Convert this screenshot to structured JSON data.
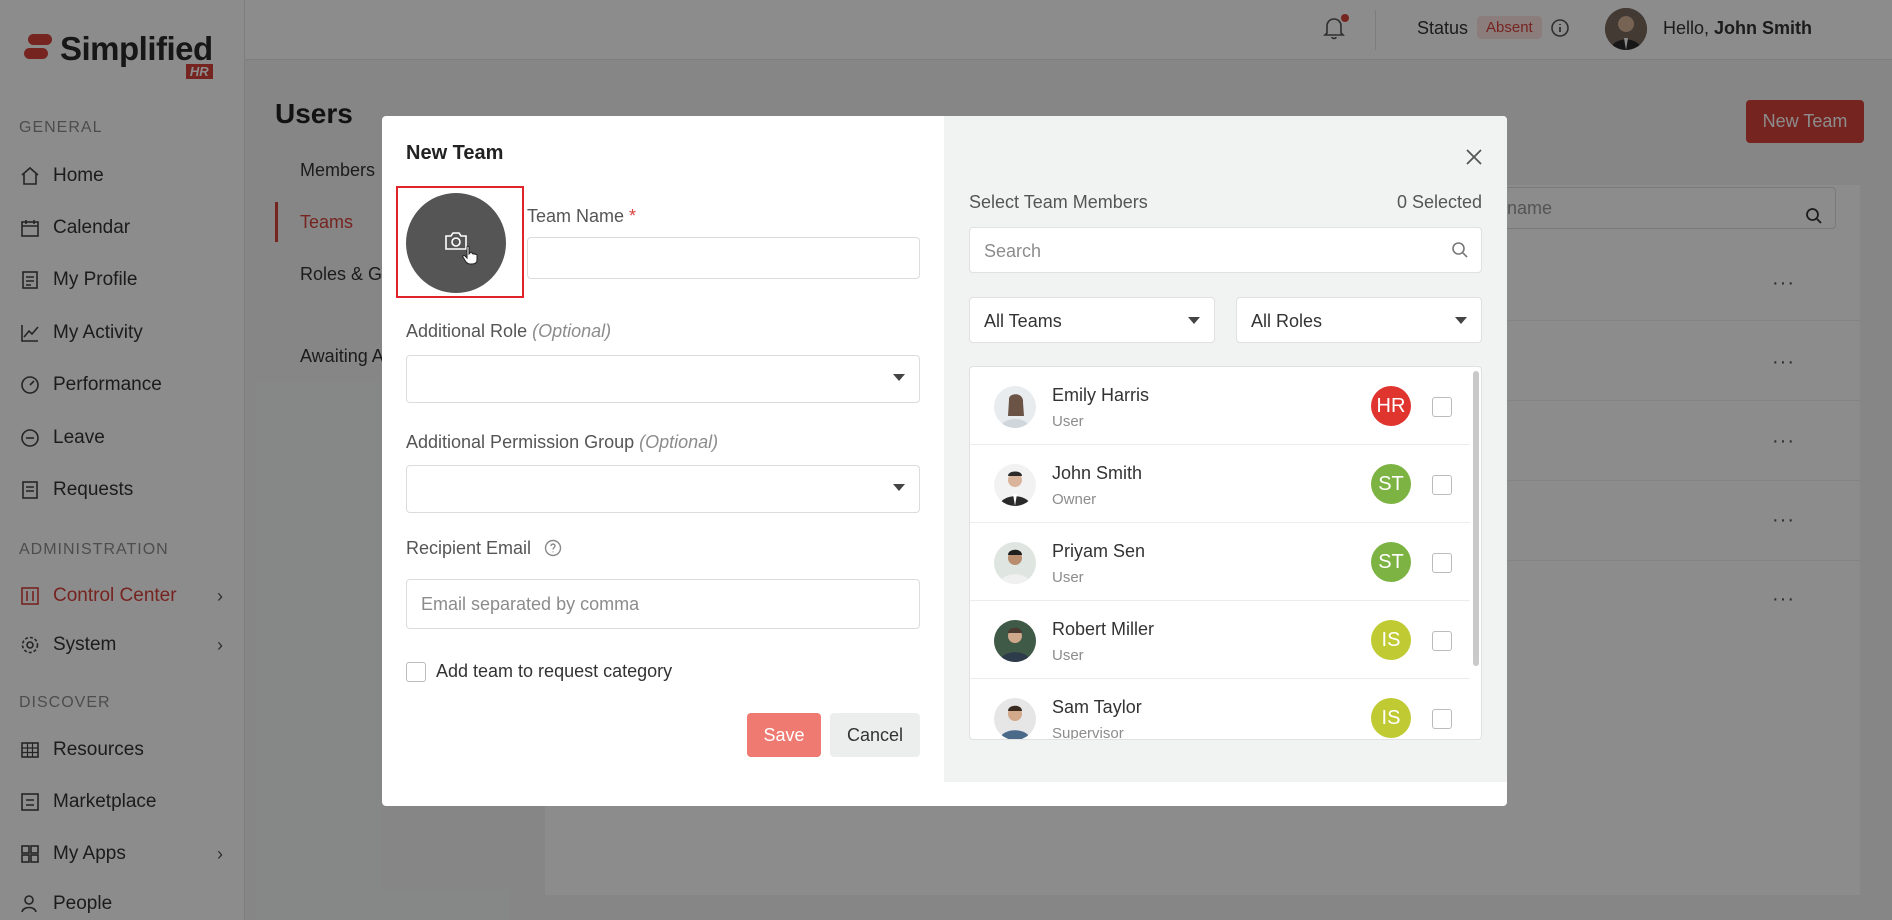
{
  "app": {
    "logo_text": "Simplified",
    "logo_badge": "HR",
    "brand_color": "#d8433b"
  },
  "sidebar": {
    "sections": [
      {
        "label": "GENERAL"
      },
      {
        "label": "ADMINISTRATION"
      },
      {
        "label": "DISCOVER"
      }
    ],
    "items": [
      {
        "label": "Home",
        "icon": "home-icon"
      },
      {
        "label": "Calendar",
        "icon": "calendar-icon"
      },
      {
        "label": "My Profile",
        "icon": "profile-icon"
      },
      {
        "label": "My Activity",
        "icon": "activity-icon"
      },
      {
        "label": "Performance",
        "icon": "gauge-icon"
      },
      {
        "label": "Leave",
        "icon": "leave-icon"
      },
      {
        "label": "Requests",
        "icon": "requests-icon"
      },
      {
        "label": "Control Center",
        "icon": "control-icon"
      },
      {
        "label": "System",
        "icon": "gear-icon"
      },
      {
        "label": "Resources",
        "icon": "grid-icon"
      },
      {
        "label": "Marketplace",
        "icon": "marketplace-icon"
      },
      {
        "label": "My Apps",
        "icon": "apps-icon"
      },
      {
        "label": "People",
        "icon": "people-icon"
      }
    ]
  },
  "header": {
    "status_label": "Status",
    "status_value": "Absent",
    "hello": "Hello,",
    "user_name": "John Smith"
  },
  "page": {
    "title": "Users",
    "new_team_button": "New Team",
    "subnav": [
      "Members",
      "Teams",
      "Roles & Gr",
      "Awaiting A"
    ],
    "search_placeholder": "y name"
  },
  "modal": {
    "title": "New Team",
    "team_name_label": "Team Name",
    "required_mark": "*",
    "additional_role_label": "Additional Role",
    "additional_permission_label": "Additional Permission Group",
    "optional": "(Optional)",
    "recipient_email_label": "Recipient Email",
    "recipient_email_placeholder": "Email separated by comma",
    "add_team_checkbox_label": "Add team to request category",
    "save_button": "Save",
    "cancel_button": "Cancel",
    "members_panel": {
      "title": "Select Team Members",
      "selected_count": "0 Selected",
      "search_placeholder": "Search",
      "teams_filter": "All Teams",
      "roles_filter": "All Roles",
      "members": [
        {
          "name": "Emily Harris",
          "role": "User",
          "team": "HR",
          "team_color": "#e0342f"
        },
        {
          "name": "John Smith",
          "role": "Owner",
          "team": "ST",
          "team_color": "#7cb342"
        },
        {
          "name": "Priyam Sen",
          "role": "User",
          "team": "ST",
          "team_color": "#7cb342"
        },
        {
          "name": "Robert Miller",
          "role": "User",
          "team": "IS",
          "team_color": "#c0ca33"
        },
        {
          "name": "Sam Taylor",
          "role": "Supervisor",
          "team": "IS",
          "team_color": "#c0ca33"
        }
      ]
    }
  }
}
